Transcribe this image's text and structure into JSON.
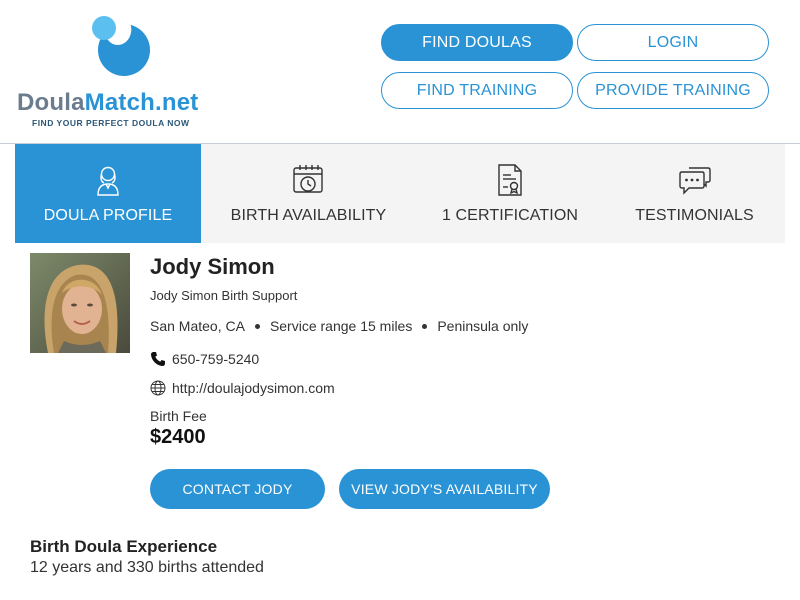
{
  "brand": {
    "name_part1": "Doula",
    "name_part2": "Match.net",
    "tagline": "FIND YOUR PERFECT DOULA NOW",
    "colors": {
      "primary": "#2a93d5",
      "light": "#5bc0f0",
      "gray": "#6b7c8f"
    }
  },
  "nav": {
    "find_doulas": "FIND DOULAS",
    "login": "LOGIN",
    "find_training": "FIND TRAINING",
    "provide_training": "PROVIDE TRAINING"
  },
  "tabs": [
    {
      "label": "DOULA PROFILE",
      "icon": "person-icon",
      "active": true
    },
    {
      "label": "BIRTH AVAILABILITY",
      "icon": "calendar-clock-icon",
      "active": false
    },
    {
      "label": "1 CERTIFICATION",
      "icon": "certificate-icon",
      "active": false
    },
    {
      "label": "TESTIMONIALS",
      "icon": "chat-bubbles-icon",
      "active": false
    }
  ],
  "profile": {
    "name": "Jody Simon",
    "business": "Jody Simon Birth Support",
    "location": "San Mateo, CA",
    "service_range": "Service range 15 miles",
    "area": "Peninsula only",
    "phone": "650-759-5240",
    "website": "http://doulajodysimon.com",
    "fee_label": "Birth Fee",
    "fee_value": "$2400",
    "contact_button": "CONTACT JODY",
    "availability_button": "VIEW JODY'S AVAILABILITY"
  },
  "experience": {
    "title": "Birth Doula Experience",
    "value": "12 years and 330 births attended"
  }
}
